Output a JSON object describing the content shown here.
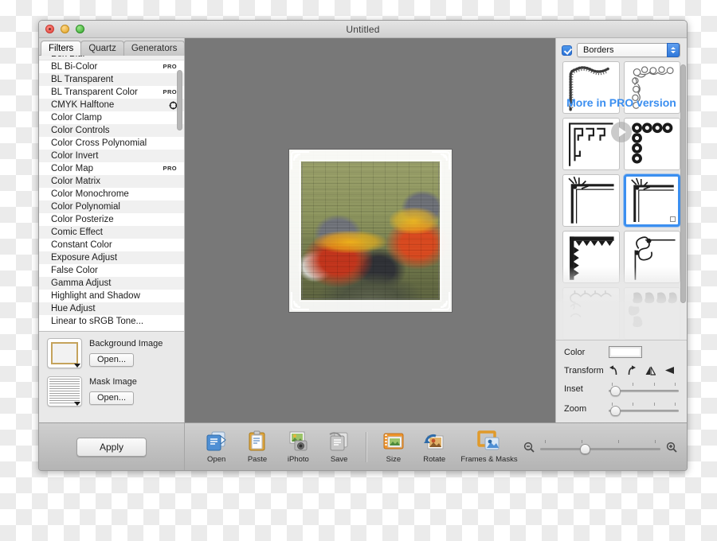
{
  "window": {
    "title": "Untitled",
    "traffic_lights": [
      "close-red",
      "minimize-yellow",
      "zoom-green"
    ]
  },
  "left_panel": {
    "tabs": [
      {
        "label": "Filters",
        "active": true
      },
      {
        "label": "Quartz",
        "active": false
      },
      {
        "label": "Generators",
        "active": false
      }
    ],
    "filters": [
      {
        "name": "BL Bi-Color",
        "badge": "PRO"
      },
      {
        "name": "BL Transparent",
        "badge": ""
      },
      {
        "name": "BL Transparent Color",
        "badge": "PRO"
      },
      {
        "name": "CMYK Halftone",
        "badge": "icon"
      },
      {
        "name": "Color Clamp",
        "badge": ""
      },
      {
        "name": "Color Controls",
        "badge": ""
      },
      {
        "name": "Color Cross Polynomial",
        "badge": ""
      },
      {
        "name": "Color Invert",
        "badge": ""
      },
      {
        "name": "Color Map",
        "badge": "PRO"
      },
      {
        "name": "Color Matrix",
        "badge": ""
      },
      {
        "name": "Color Monochrome",
        "badge": ""
      },
      {
        "name": "Color Polynomial",
        "badge": ""
      },
      {
        "name": "Color Posterize",
        "badge": ""
      },
      {
        "name": "Comic Effect",
        "badge": ""
      },
      {
        "name": "Constant Color",
        "badge": ""
      },
      {
        "name": "Exposure Adjust",
        "badge": ""
      },
      {
        "name": "False Color",
        "badge": ""
      },
      {
        "name": "Gamma Adjust",
        "badge": ""
      },
      {
        "name": "Highlight and Shadow",
        "badge": ""
      },
      {
        "name": "Hue Adjust",
        "badge": ""
      },
      {
        "name": "Linear to sRGB Tone...",
        "badge": ""
      }
    ],
    "image_inputs": [
      {
        "label": "Background Image",
        "button": "Open..."
      },
      {
        "label": "Mask Image",
        "button": "Open..."
      }
    ]
  },
  "right_panel": {
    "category_enabled": true,
    "category": "Borders",
    "selected_thumbnail_index": 5,
    "thumbnails": [
      {
        "name": "scalloped-leaf-border"
      },
      {
        "name": "swirl-filigree-border"
      },
      {
        "name": "greek-key-border"
      },
      {
        "name": "checker-floral-border"
      },
      {
        "name": "fan-corner-border"
      },
      {
        "name": "fan-corner-border-selected"
      },
      {
        "name": "sawtooth-border"
      },
      {
        "name": "scroll-knot-border"
      },
      {
        "name": "arch-row-border"
      },
      {
        "name": "paisley-border"
      }
    ],
    "pro_text": "More in PRO version",
    "controls": {
      "color_label": "Color",
      "color_value": "#ffffff",
      "transform_label": "Transform",
      "transform_icons": [
        "rotate-left-icon",
        "rotate-right-icon",
        "flip-horizontal-icon",
        "flip-vertical-icon"
      ],
      "inset_label": "Inset",
      "inset_value": 3,
      "zoom_label": "Zoom",
      "zoom_value": 3
    }
  },
  "bottom_bar": {
    "apply_label": "Apply",
    "tools": [
      {
        "label": "Open",
        "icon": "open-document-icon"
      },
      {
        "label": "Paste",
        "icon": "clipboard-paste-icon"
      },
      {
        "label": "iPhoto",
        "icon": "iphoto-camera-icon"
      },
      {
        "label": "Save",
        "icon": "save-document-icon"
      },
      {
        "label": "Size",
        "icon": "resize-image-icon"
      },
      {
        "label": "Rotate",
        "icon": "rotate-image-icon"
      },
      {
        "label": "Frames & Masks",
        "icon": "frames-masks-icon"
      }
    ],
    "zoom": {
      "out_icon": "zoom-out-icon",
      "in_icon": "zoom-in-icon",
      "value": 33
    }
  },
  "canvas": {
    "artwork_name": "rainbow-lorikeets-brick-texture",
    "frame_style": "ornate-white-corner-frame",
    "background_color": "#787878"
  }
}
